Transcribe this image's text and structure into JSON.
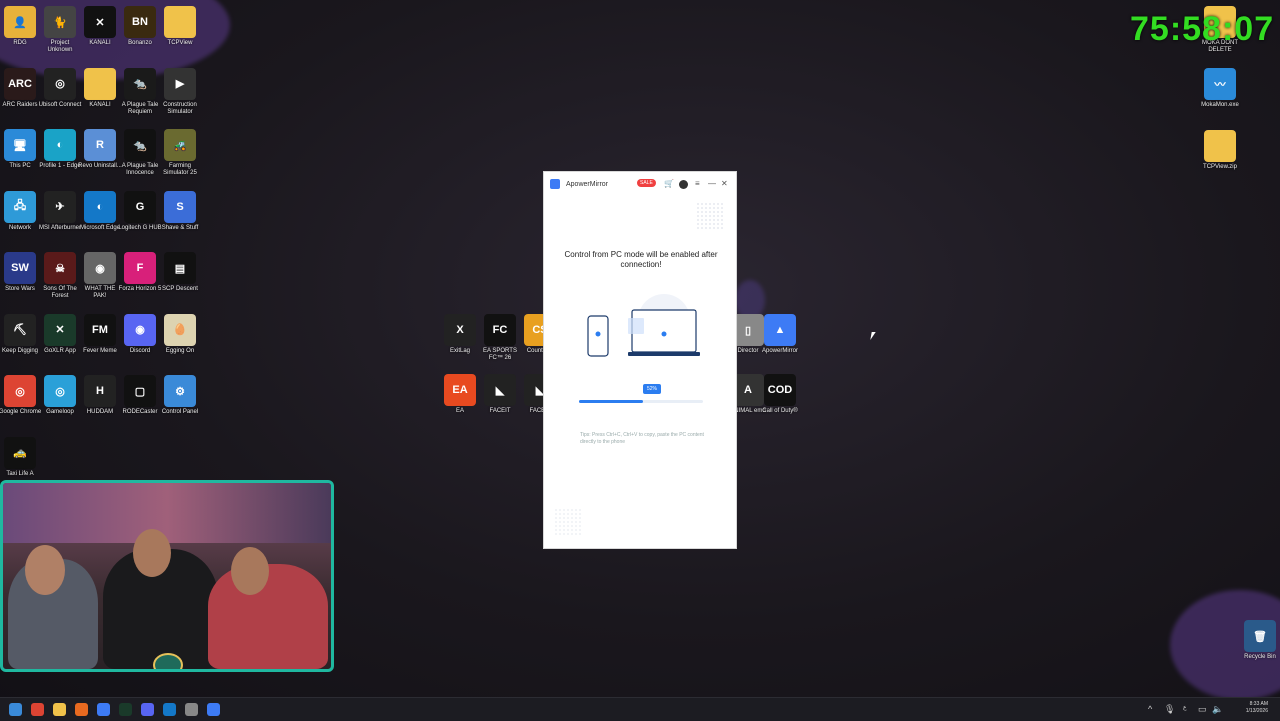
{
  "stream": {
    "timer": "75:58:07"
  },
  "desktop": {
    "left_icons": [
      {
        "label": "RDG",
        "color": "#e8b23a",
        "glyph": "👤"
      },
      {
        "label": "Project Unknown",
        "color": "#444",
        "glyph": "🐈"
      },
      {
        "label": "KANALI",
        "color": "#111",
        "glyph": "✕"
      },
      {
        "label": "Bonanzo",
        "color": "#3a2a10",
        "glyph": "BN"
      },
      {
        "label": "TCPView",
        "color": "#f0c24a",
        "glyph": ""
      },
      {
        "label": "ARC Raiders",
        "color": "#2a1a1a",
        "glyph": "ARC"
      },
      {
        "label": "Ubisoft Connect",
        "color": "#222",
        "glyph": "◎"
      },
      {
        "label": "KANALI",
        "color": "#f0c24a",
        "glyph": ""
      },
      {
        "label": "A Plague Tale Requiem",
        "color": "#1a1a1a",
        "glyph": "🐀"
      },
      {
        "label": "Construction Simulator",
        "color": "#333",
        "glyph": "▶"
      },
      {
        "label": "This PC",
        "color": "#2b8ad8",
        "glyph": "🖥"
      },
      {
        "label": "Profile 1 - Edge",
        "color": "#1aa3c7",
        "glyph": "◐"
      },
      {
        "label": "Revo Uninstall...",
        "color": "#5b8fd6",
        "glyph": "R"
      },
      {
        "label": "A Plague Tale Innocence",
        "color": "#111",
        "glyph": "🐀"
      },
      {
        "label": "Farming Simulator 25",
        "color": "#6a6a30",
        "glyph": "🚜"
      },
      {
        "label": "Network",
        "color": "#2e9ad8",
        "glyph": "🖧"
      },
      {
        "label": "MSI Afterburner",
        "color": "#222",
        "glyph": "✈"
      },
      {
        "label": "Microsoft Edge",
        "color": "#1478c8",
        "glyph": "◐"
      },
      {
        "label": "Logitech G HUB",
        "color": "#111",
        "glyph": "G"
      },
      {
        "label": "Shave & Stuff",
        "color": "#3b6dd8",
        "glyph": "S"
      },
      {
        "label": "Store Wars",
        "color": "#2a3a8a",
        "glyph": "SW"
      },
      {
        "label": "Sons Of The Forest",
        "color": "#5a1a1a",
        "glyph": "☠"
      },
      {
        "label": "WHAT THE PAK!",
        "color": "#666",
        "glyph": "◉"
      },
      {
        "label": "Forza Horizon 5",
        "color": "#d8207a",
        "glyph": "F"
      },
      {
        "label": "SCP Descent",
        "color": "#111",
        "glyph": "▤"
      },
      {
        "label": "Keep Digging",
        "color": "#222",
        "glyph": "⛏"
      },
      {
        "label": "GoXLR App",
        "color": "#1a3a2a",
        "glyph": "✕"
      },
      {
        "label": "Fever Meme",
        "color": "#111",
        "glyph": "FM"
      },
      {
        "label": "Discord",
        "color": "#5865f2",
        "glyph": "◉"
      },
      {
        "label": "Egging On",
        "color": "#ddd3b0",
        "glyph": "🥚"
      },
      {
        "label": "Google Chrome",
        "color": "#dd4433",
        "glyph": "◎"
      },
      {
        "label": "Gameloop",
        "color": "#2aa0d8",
        "glyph": "◎"
      },
      {
        "label": "HUDDAM",
        "color": "#222",
        "glyph": "H"
      },
      {
        "label": "RODECaster",
        "color": "#111",
        "glyph": "▢"
      },
      {
        "label": "Control Panel",
        "color": "#3a8ad8",
        "glyph": "⚙"
      },
      {
        "label": "Taxi Life A",
        "color": "#111",
        "glyph": "🚕"
      }
    ],
    "center_icons": [
      {
        "label": "ExitLag",
        "color": "#222",
        "glyph": "X"
      },
      {
        "label": "EA SPORTS FC™ 26",
        "color": "#111",
        "glyph": "FC"
      },
      {
        "label": "Counter 2",
        "color": "#e8a020",
        "glyph": "CS"
      },
      {
        "label": "Director",
        "color": "#888",
        "glyph": "▯"
      },
      {
        "label": "ApowerMirror",
        "color": "#3d7bf5",
        "glyph": "▲"
      },
      {
        "label": "EA",
        "color": "#e84a20",
        "glyph": "EA"
      },
      {
        "label": "FACEIT",
        "color": "#222",
        "glyph": "◣"
      },
      {
        "label": "FACEIT",
        "color": "#222",
        "glyph": "◣"
      },
      {
        "label": "ANIMAL emo",
        "color": "#333",
        "glyph": "A"
      },
      {
        "label": "Call of Duty®",
        "color": "#111",
        "glyph": "COD"
      }
    ],
    "right_icons": [
      {
        "label": "MOKA DONT DELETE",
        "color": "#f0c24a",
        "glyph": ""
      },
      {
        "label": "MokaMon.exe",
        "color": "#2a8ad8",
        "glyph": "〰"
      },
      {
        "label": "TCPView.zip",
        "color": "#f0c24a",
        "glyph": ""
      },
      {
        "label": "Recycle Bin",
        "color": "#2a5a8a",
        "glyph": "🗑"
      }
    ]
  },
  "app": {
    "title": "ApowerMirror",
    "sale_badge": "SALE",
    "message": "Control from PC mode will be enabled after connection!",
    "progress_label": "52%",
    "progress_value": 0.52,
    "tips": "Tips: Press Ctrl+C, Ctrl+V to copy, paste the PC content directly to the phone",
    "accent": "#2b7df0"
  },
  "taskbar": {
    "time": "8:33 AM",
    "date": "1/13/2026",
    "apps": [
      "start-icon",
      "chrome-icon",
      "explorer-icon",
      "tool-icon",
      "window-icon",
      "xlr-icon",
      "discord-icon",
      "edge-icon",
      "calc-icon",
      "apowermirror-icon"
    ]
  }
}
